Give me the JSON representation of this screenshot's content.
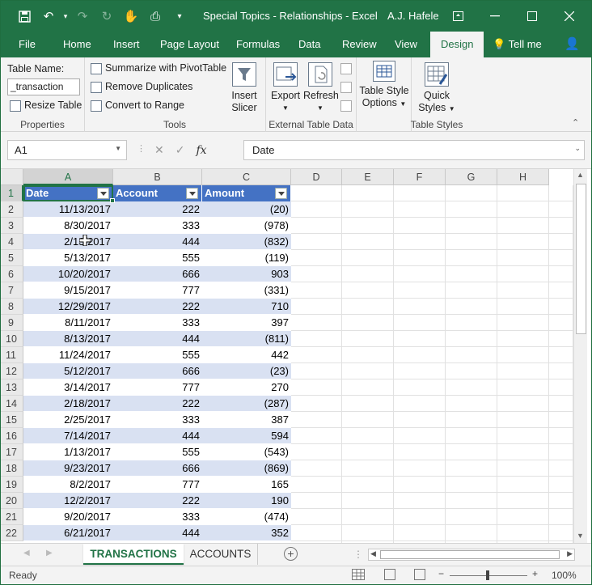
{
  "titlebar": {
    "title": "Special Topics - Relationships  -  Excel",
    "user": "A.J. Hafele"
  },
  "tabs": [
    "File",
    "Home",
    "Insert",
    "Page Layout",
    "Formulas",
    "Data",
    "Review",
    "View",
    "Design"
  ],
  "tellme": "Tell me",
  "active_tab": "Design",
  "ribbon": {
    "properties": {
      "label": "Table Name:",
      "value": "_transaction",
      "resize": "Resize Table",
      "group": "Properties"
    },
    "tools": {
      "summarize": "Summarize with PivotTable",
      "remove_dupes": "Remove Duplicates",
      "convert": "Convert to Range",
      "group": "Tools"
    },
    "slicer": {
      "line1": "Insert",
      "line2": "Slicer"
    },
    "external": {
      "export": "Export",
      "refresh": "Refresh",
      "group": "External Table Data"
    },
    "style_options": {
      "line1": "Table Style",
      "line2": "Options"
    },
    "styles": {
      "line1": "Quick",
      "line2": "Styles",
      "group": "Table Styles"
    }
  },
  "formula_bar": {
    "name_box": "A1",
    "formula": "Date"
  },
  "columns": [
    "A",
    "B",
    "C",
    "D",
    "E",
    "F",
    "G",
    "H"
  ],
  "table": {
    "headers": [
      "Date",
      "Account",
      "Amount"
    ],
    "rows": [
      [
        "11/13/2017",
        "222",
        "(20)"
      ],
      [
        "8/30/2017",
        "333",
        "(978)"
      ],
      [
        "2/13/2017",
        "444",
        "(832)"
      ],
      [
        "5/13/2017",
        "555",
        "(119)"
      ],
      [
        "10/20/2017",
        "666",
        "903"
      ],
      [
        "9/15/2017",
        "777",
        "(331)"
      ],
      [
        "12/29/2017",
        "222",
        "710"
      ],
      [
        "8/11/2017",
        "333",
        "397"
      ],
      [
        "8/13/2017",
        "444",
        "(811)"
      ],
      [
        "11/24/2017",
        "555",
        "442"
      ],
      [
        "5/12/2017",
        "666",
        "(23)"
      ],
      [
        "3/14/2017",
        "777",
        "270"
      ],
      [
        "2/18/2017",
        "222",
        "(287)"
      ],
      [
        "2/25/2017",
        "333",
        "387"
      ],
      [
        "7/14/2017",
        "444",
        "594"
      ],
      [
        "1/13/2017",
        "555",
        "(543)"
      ],
      [
        "9/23/2017",
        "666",
        "(869)"
      ],
      [
        "8/2/2017",
        "777",
        "165"
      ],
      [
        "12/2/2017",
        "222",
        "190"
      ],
      [
        "9/20/2017",
        "333",
        "(474)"
      ],
      [
        "6/21/2017",
        "444",
        "352"
      ]
    ]
  },
  "row_numbers": [
    "1",
    "2",
    "3",
    "4",
    "5",
    "6",
    "7",
    "8",
    "9",
    "10",
    "11",
    "12",
    "13",
    "14",
    "15",
    "16",
    "17",
    "18",
    "19",
    "20",
    "21",
    "22"
  ],
  "sheets": [
    "TRANSACTIONS",
    "ACCOUNTS"
  ],
  "status": {
    "ready": "Ready",
    "zoom": "100%"
  },
  "colors": {
    "excel_green": "#217346",
    "table_header": "#4472c4",
    "band": "#d9e1f2"
  }
}
